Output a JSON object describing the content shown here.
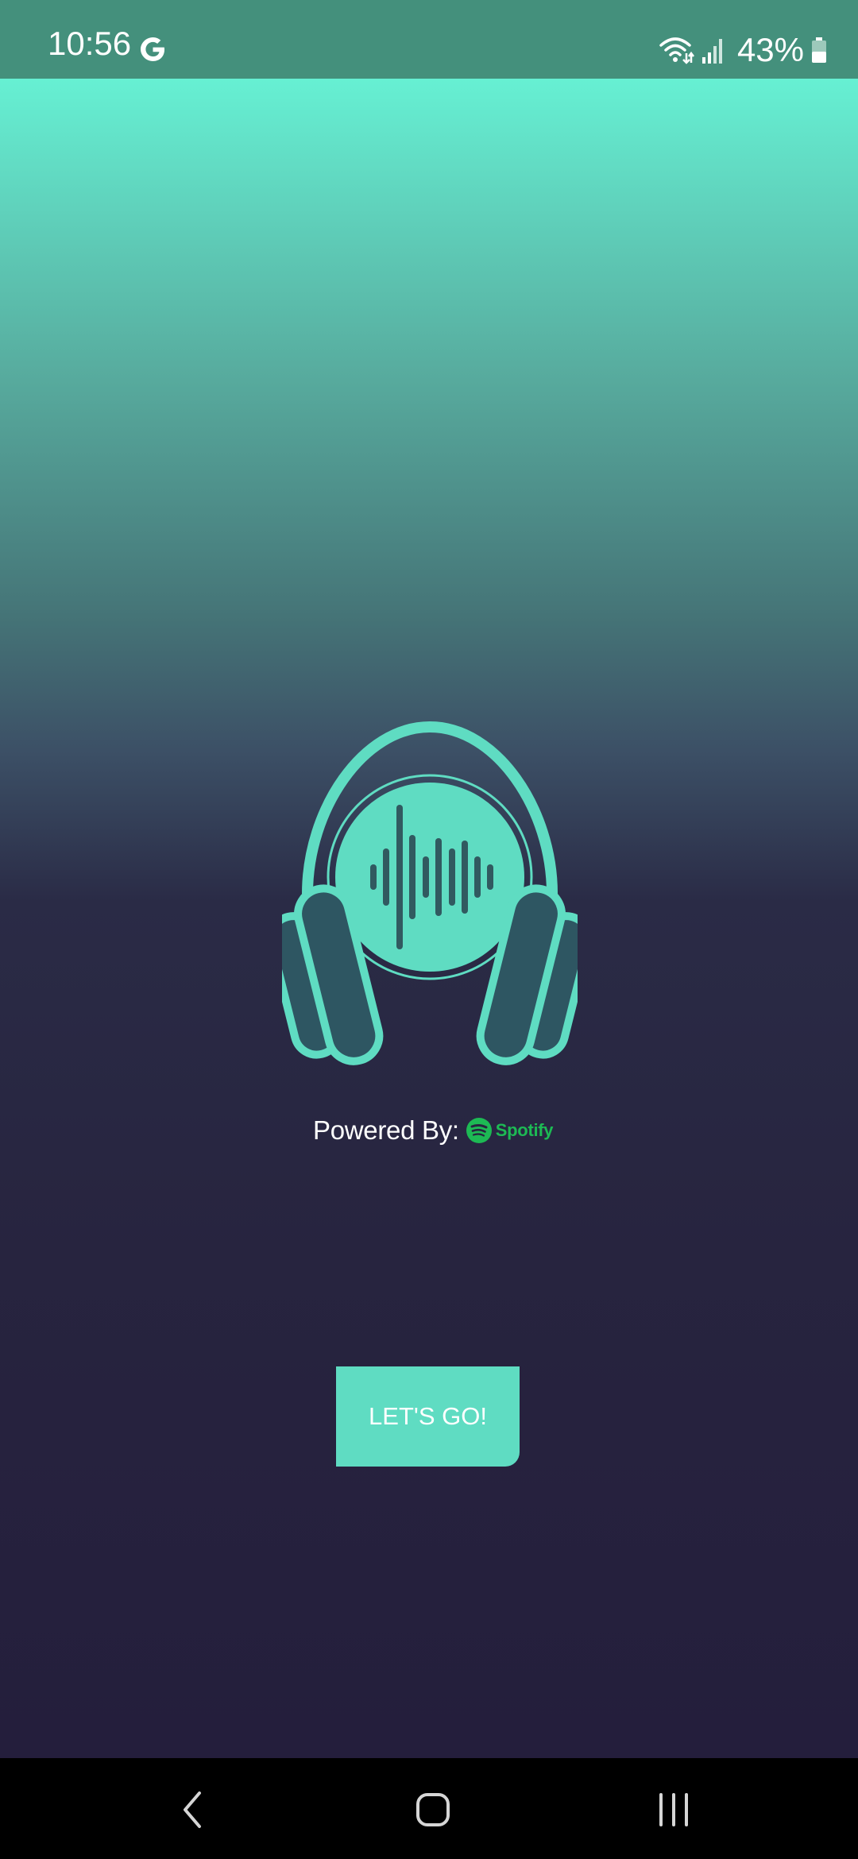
{
  "status_bar": {
    "time": "10:56",
    "battery": "43%",
    "icons": [
      "google-icon",
      "wifi-icon",
      "signal-icon",
      "battery-icon"
    ]
  },
  "app": {
    "logo_icon": "headphones-soundwave-icon",
    "powered_by_label": "Powered By:",
    "partner_logo_text": "Spotify",
    "cta_label": "LET'S GO!",
    "colors": {
      "accent": "#5fdcc2",
      "spotify_green": "#1db954",
      "gradient_top": "#66f0d3",
      "gradient_bottom": "#241e3c"
    }
  },
  "nav_bar": {
    "icons": [
      "back-icon",
      "home-icon",
      "recents-icon"
    ]
  }
}
